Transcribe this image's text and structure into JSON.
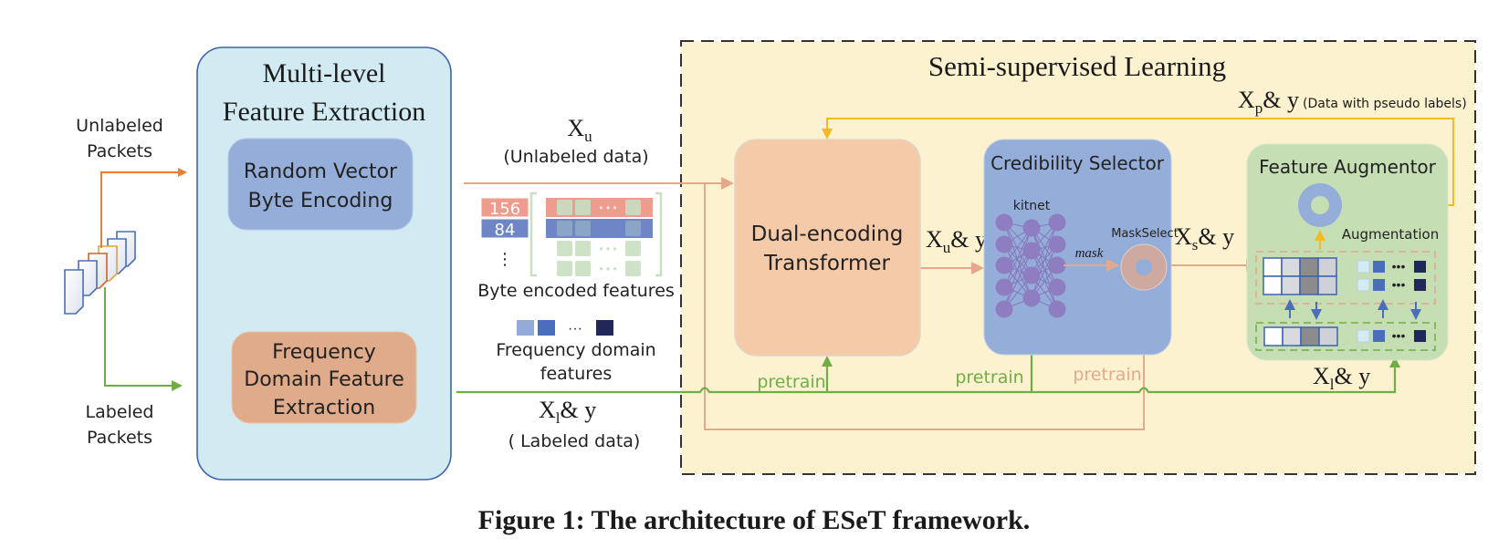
{
  "inputs": {
    "unlabeled_label_1": "Unlabeled",
    "unlabeled_label_2": "Packets",
    "labeled_label_1": "Labeled",
    "labeled_label_2": "Packets"
  },
  "extraction": {
    "title_1": "Multi-level",
    "title_2": "Feature Extraction",
    "random_vector_1": "Random Vector",
    "random_vector_2": "Byte Encoding",
    "frequency_1": "Frequency",
    "frequency_2": "Domain Feature",
    "frequency_3": "Extraction"
  },
  "middle": {
    "xu_main": "X",
    "xu_sub": "u",
    "unlabeled_data": "(Unlabeled data)",
    "byte_value_1": "156",
    "byte_value_2": "84",
    "vertical_dots": "⋮",
    "dots": "···",
    "byte_features": "Byte encoded features",
    "freq_features_1": "Frequency domain",
    "freq_features_2": "features",
    "xl_main": "X",
    "xl_sub": "l",
    "xl_suffix": "& y",
    "labeled_data": "( Labeled data)"
  },
  "ssl": {
    "title": "Semi-supervised Learning",
    "xp_main": "X",
    "xp_sub": "p",
    "xp_suffix": "& y",
    "xp_note": "(Data with pseudo labels)",
    "transformer_1": "Dual-encoding",
    "transformer_2": "Transformer",
    "xu_main": "X",
    "xu_sub": "u",
    "xu_suffix": "& y",
    "selector_title": "Credibility Selector",
    "kitnet": "kitnet",
    "mask": "mask",
    "mask_select": "MaskSelect",
    "xs_main": "X",
    "xs_sub": "s",
    "xs_suffix": "& y",
    "augmentor_title": "Feature Augmentor",
    "augmentation": "Augmentation",
    "xl_main": "X",
    "xl_sub": "l",
    "xl_suffix": "& y",
    "pretrain_1": "pretrain",
    "pretrain_2": "pretrain",
    "pretrain_3": "pretrain"
  },
  "caption": "Figure 1: The architecture of ESeT framework.",
  "colors": {
    "orange_arrow": "#ed7d31",
    "green_arrow": "#70ad47",
    "yellow_arrow": "#f4b923",
    "peach_arrow": "#e3a98a",
    "ssl_bg": "#fdf2cf",
    "extraction_bg": "#d2eaf2",
    "blue_box": "#94aed9",
    "orange_box": "#dfab8a",
    "transformer_box": "#f5caa8",
    "augmentor_box": "#c5deb3",
    "node_purple": "#8e7dc0"
  }
}
